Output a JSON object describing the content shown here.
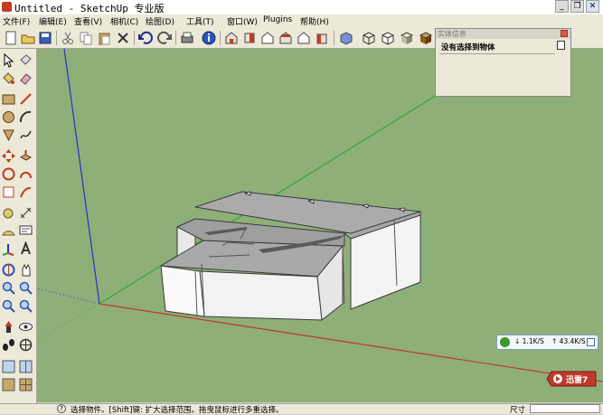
{
  "window": {
    "title": "Untitled - SketchUp 专业版",
    "buttons": {
      "minimize": "_",
      "restore": "❐",
      "close": "✕"
    }
  },
  "menus": [
    "文件(F)",
    "编辑(E)",
    "查看(V)",
    "相机(C)",
    "绘图(D)",
    "工具(T)",
    "窗口(W)",
    "Plugins",
    "帮助(H)"
  ],
  "toolbar": {
    "icons": [
      "new-icon",
      "open-icon",
      "save-icon",
      "cut-icon",
      "copy-icon",
      "paste-icon",
      "erase-icon",
      "undo-icon",
      "redo-icon",
      "print-icon",
      "model-info-icon",
      "iso-view-icon",
      "top-view-icon",
      "front-view-icon",
      "right-view-icon",
      "back-view-icon",
      "left-view-icon",
      "xray-icon",
      "wireframe-icon",
      "hidden-line-icon",
      "shaded-icon",
      "textured-icon"
    ]
  },
  "left_toolbar": {
    "icons": [
      "select-icon",
      "make-component-icon",
      "paint-bucket-icon",
      "eraser-icon",
      "rectangle-icon",
      "line-icon",
      "circle-icon",
      "arc-icon",
      "polygon-icon",
      "freehand-icon",
      "move-icon",
      "push-pull-icon",
      "rotate-icon",
      "follow-me-icon",
      "scale-icon",
      "offset-icon",
      "tape-measure-icon",
      "dimension-icon",
      "protractor-icon",
      "text-icon",
      "axes-icon",
      "3d-text-icon",
      "orbit-icon",
      "pan-icon",
      "zoom-icon",
      "zoom-window-icon",
      "zoom-extents-icon",
      "previous-view-icon",
      "position-camera-icon",
      "look-around-icon",
      "walk-icon",
      "section-plane-icon",
      "style-1-icon",
      "style-2-icon",
      "style-3-icon",
      "style-4-icon"
    ]
  },
  "entity_info": {
    "title": "实体信息",
    "text": "没有选择到物体"
  },
  "network_widget": {
    "down": "1.1K/S",
    "up": "43.4K/S"
  },
  "xunlei": {
    "label": "迅雷7"
  },
  "statusbar": {
    "hint": "选择物件。[Shift]键: 扩大选择范围。拖曳鼠标进行多重选择。",
    "dimensions_label": "尺寸",
    "dimensions_value": ""
  },
  "colors": {
    "sky_ground": "#8faf79",
    "red_axis": "#c0392b",
    "green_axis": "#2fa82f",
    "blue_axis": "#2233cc"
  }
}
